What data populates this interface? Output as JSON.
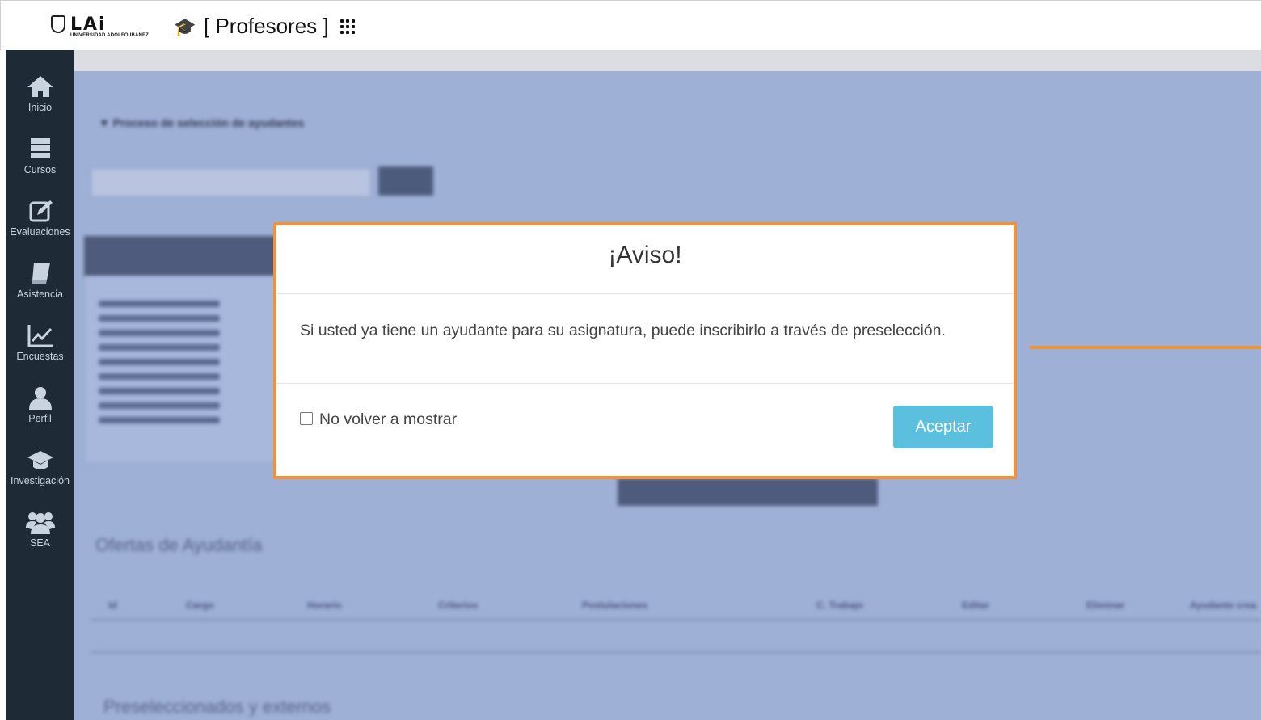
{
  "header": {
    "logo_letters": "LAi",
    "logo_subtitle": "UNIVERSIDAD ADOLFO IBÁÑEZ",
    "portal_title": "[ Profesores ]"
  },
  "sidebar": {
    "items": [
      {
        "label": "Inicio",
        "icon": "home-icon"
      },
      {
        "label": "Cursos",
        "icon": "courses-icon"
      },
      {
        "label": "Evaluaciones",
        "icon": "edit-icon"
      },
      {
        "label": "Asistencia",
        "icon": "book-icon"
      },
      {
        "label": "Encuestas",
        "icon": "chart-icon"
      },
      {
        "label": "Perfil",
        "icon": "user-icon"
      },
      {
        "label": "Investigación",
        "icon": "graduation-cap-icon"
      },
      {
        "label": "SEA",
        "icon": "users-icon"
      }
    ]
  },
  "background": {
    "section_title": "▼ Proceso de selección de ayudantes",
    "ofertas_title": "Ofertas de Ayudantía",
    "preseleccionados_title": "Preseleccionados y externos",
    "table_headers": [
      "Id",
      "Cargo",
      "Horario",
      "Criterios",
      "Postulaciones",
      "C. Trabajo",
      "Editar",
      "Eliminar",
      "Ayudante crea"
    ]
  },
  "modal": {
    "title": "¡Aviso!",
    "message": "Si usted ya tiene un ayudante para su asignatura, puede inscribirlo a través de preselección.",
    "checkbox_label": "No volver a mostrar",
    "accept_label": "Aceptar"
  },
  "colors": {
    "sidebar_bg": "#1f2a37",
    "overlay_bg": "#9fb0d6",
    "highlight": "#f0923a",
    "accept_button": "#5bc0de"
  }
}
